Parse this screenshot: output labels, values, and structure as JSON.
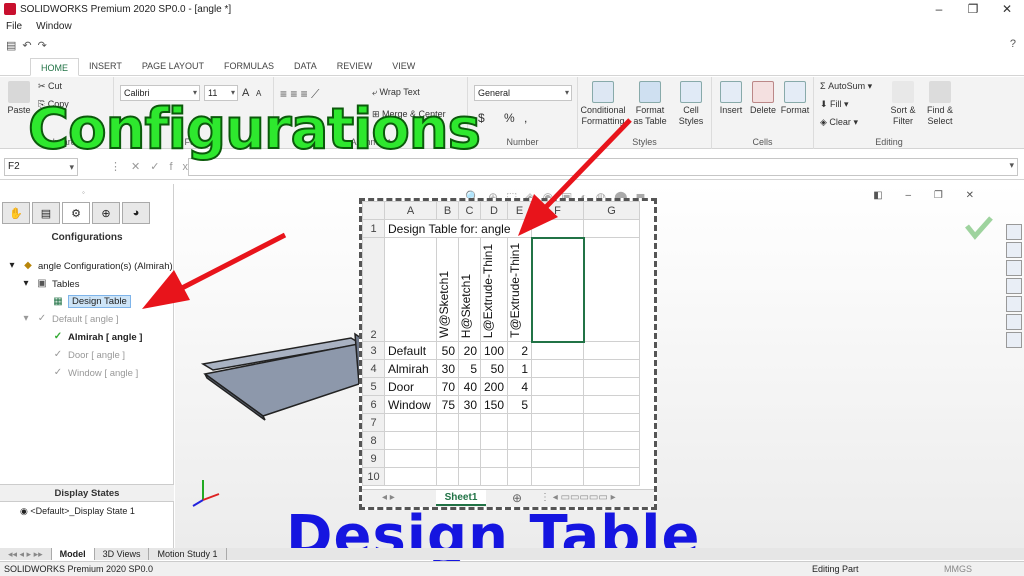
{
  "window": {
    "title": "SOLIDWORKS Premium 2020 SP0.0 - [angle *]",
    "controls": [
      "–",
      "❐",
      "✕"
    ]
  },
  "menu": [
    "File",
    "Window"
  ],
  "qat": {
    "help": "?"
  },
  "ribbon_tabs": [
    "HOME",
    "INSERT",
    "PAGE LAYOUT",
    "FORMULAS",
    "DATA",
    "REVIEW",
    "VIEW"
  ],
  "ribbon": {
    "clipboard": {
      "paste": "Paste",
      "cut": "Cut",
      "copy": "Copy",
      "label": "Clipboard"
    },
    "font": {
      "name": "Calibri",
      "size": "11",
      "grow": "A",
      "shrink": "A",
      "label": "Font"
    },
    "alignment": {
      "wrap": "Wrap Text",
      "merge": "Merge & Center",
      "label": "Alignment"
    },
    "number": {
      "format": "General",
      "currency": "$",
      "percent": "%",
      "comma": ",",
      "label": "Number"
    },
    "styles": {
      "conditional": "Conditional Formatting",
      "format_table": "Format as Table",
      "cell_styles": "Cell Styles",
      "label": "Styles"
    },
    "cells": {
      "insert": "Insert",
      "delete": "Delete",
      "format": "Format",
      "label": "Cells"
    },
    "editing": {
      "autosum": "AutoSum",
      "fill": "Fill",
      "clear": "Clear",
      "sort": "Sort & Filter",
      "find": "Find & Select",
      "label": "Editing"
    }
  },
  "formula_bar": {
    "name_box": "F2",
    "fx": "fx"
  },
  "left_pane": {
    "header": "Configurations",
    "tree": [
      {
        "label": "angle Configuration(s)  (Almirah)",
        "state": "normal"
      },
      {
        "label": "Tables",
        "state": "normal"
      },
      {
        "label": "Design Table",
        "state": "selected"
      },
      {
        "label": "Default [ angle ]",
        "state": "dim"
      },
      {
        "label": "Almirah [ angle ]",
        "state": "active"
      },
      {
        "label": "Door [ angle ]",
        "state": "dim"
      },
      {
        "label": "Window [ angle ]",
        "state": "dim"
      }
    ],
    "display_states_header": "Display States",
    "display_state": "<Default>_Display State 1"
  },
  "sheet": {
    "columns": [
      "A",
      "B",
      "C",
      "D",
      "E",
      "F",
      "G"
    ],
    "title_cell": "Design Table for: angle",
    "param_headers": [
      "W@Sketch1",
      "H@Sketch1",
      "L@Extrude-Thin1",
      "T@Extrude-Thin1"
    ],
    "rows": [
      {
        "name": "Default",
        "values": [
          "50",
          "20",
          "100",
          "2"
        ]
      },
      {
        "name": "Almirah",
        "values": [
          "30",
          "5",
          "50",
          "1"
        ]
      },
      {
        "name": "Door",
        "values": [
          "70",
          "40",
          "200",
          "4"
        ]
      },
      {
        "name": "Window",
        "values": [
          "75",
          "30",
          "150",
          "5"
        ]
      }
    ],
    "row_numbers": [
      "1",
      "2",
      "3",
      "4",
      "5",
      "6",
      "7",
      "8",
      "9",
      "10"
    ],
    "tab": "Sheet1"
  },
  "bottom_tabs": [
    "Model",
    "3D Views",
    "Motion Study 1"
  ],
  "status": {
    "left": "SOLIDWORKS Premium 2020 SP0.0",
    "mode": "Editing Part",
    "units": "MMGS"
  },
  "overlay": {
    "top": "Configurations",
    "bottom": "Design Table"
  },
  "colors": {
    "excel_green": "#217346",
    "overlay_green": "#2ee82e",
    "overlay_blue": "#1515e0",
    "arrow_red": "#e8141b"
  }
}
